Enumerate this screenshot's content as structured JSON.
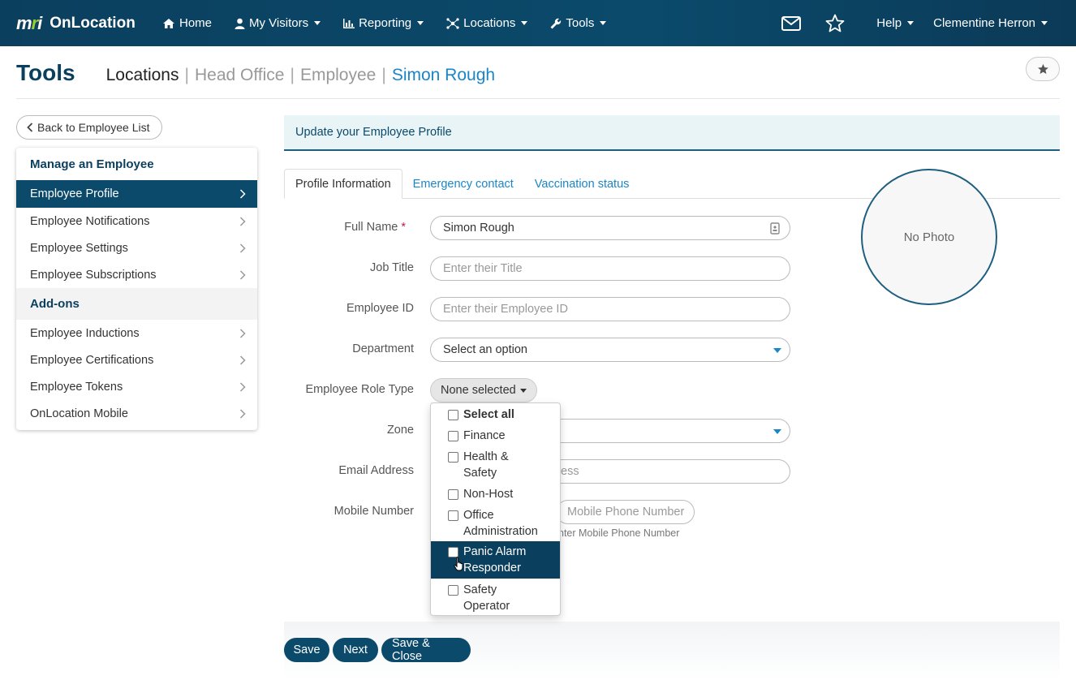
{
  "brand": {
    "mri": "mri",
    "name": "OnLocation"
  },
  "nav": {
    "items": [
      {
        "label": "Home"
      },
      {
        "label": "My Visitors"
      },
      {
        "label": "Reporting"
      },
      {
        "label": "Locations"
      },
      {
        "label": "Tools"
      }
    ],
    "help": "Help",
    "user": "Clementine Herron"
  },
  "header": {
    "title": "Tools",
    "breadcrumbs": [
      "Locations",
      "Head Office",
      "Employee",
      "Simon Rough"
    ],
    "separator": "|"
  },
  "sidebar": {
    "back_label": "Back to Employee List",
    "section1": "Manage an Employee",
    "items1": [
      "Employee Profile",
      "Employee Notifications",
      "Employee Settings",
      "Employee Subscriptions"
    ],
    "section2": "Add-ons",
    "items2": [
      "Employee Inductions",
      "Employee Certifications",
      "Employee Tokens",
      "OnLocation Mobile"
    ]
  },
  "main": {
    "alert": "Update your Employee Profile",
    "tabs": [
      "Profile Information",
      "Emergency contact",
      "Vaccination status"
    ],
    "photo_label": "No Photo"
  },
  "form": {
    "full_name": {
      "label": "Full Name",
      "required": "*",
      "value": "Simon Rough"
    },
    "job_title": {
      "label": "Job Title",
      "placeholder": "Enter their Title"
    },
    "employee_id": {
      "label": "Employee ID",
      "placeholder": "Enter their Employee ID"
    },
    "department": {
      "label": "Department",
      "value": "Select an option"
    },
    "role_type": {
      "label": "Employee Role Type",
      "value": "None selected"
    },
    "zone": {
      "label": "Zone"
    },
    "email": {
      "label": "Email Address",
      "placeholder_visible": "ess"
    },
    "mobile": {
      "label": "Mobile Number",
      "placeholder": "Mobile Phone Number",
      "help_visible": "nter Mobile Phone Number"
    }
  },
  "role_options": [
    {
      "line1": "Select all",
      "line2": ""
    },
    {
      "line1": "Finance",
      "line2": ""
    },
    {
      "line1": "Health &",
      "line2": "Safety"
    },
    {
      "line1": "Non-Host",
      "line2": ""
    },
    {
      "line1": "Office",
      "line2": "Administration"
    },
    {
      "line1": "Panic Alarm",
      "line2": "Responder"
    },
    {
      "line1": "Safety",
      "line2": "Operator"
    }
  ],
  "buttons": {
    "save": "Save",
    "next": "Next",
    "save_close": "Save & Close"
  },
  "colors": {
    "primary": "#0b4a6b",
    "link": "#1a86c7",
    "required": "#c2185b",
    "accent_green": "#9acd32"
  }
}
